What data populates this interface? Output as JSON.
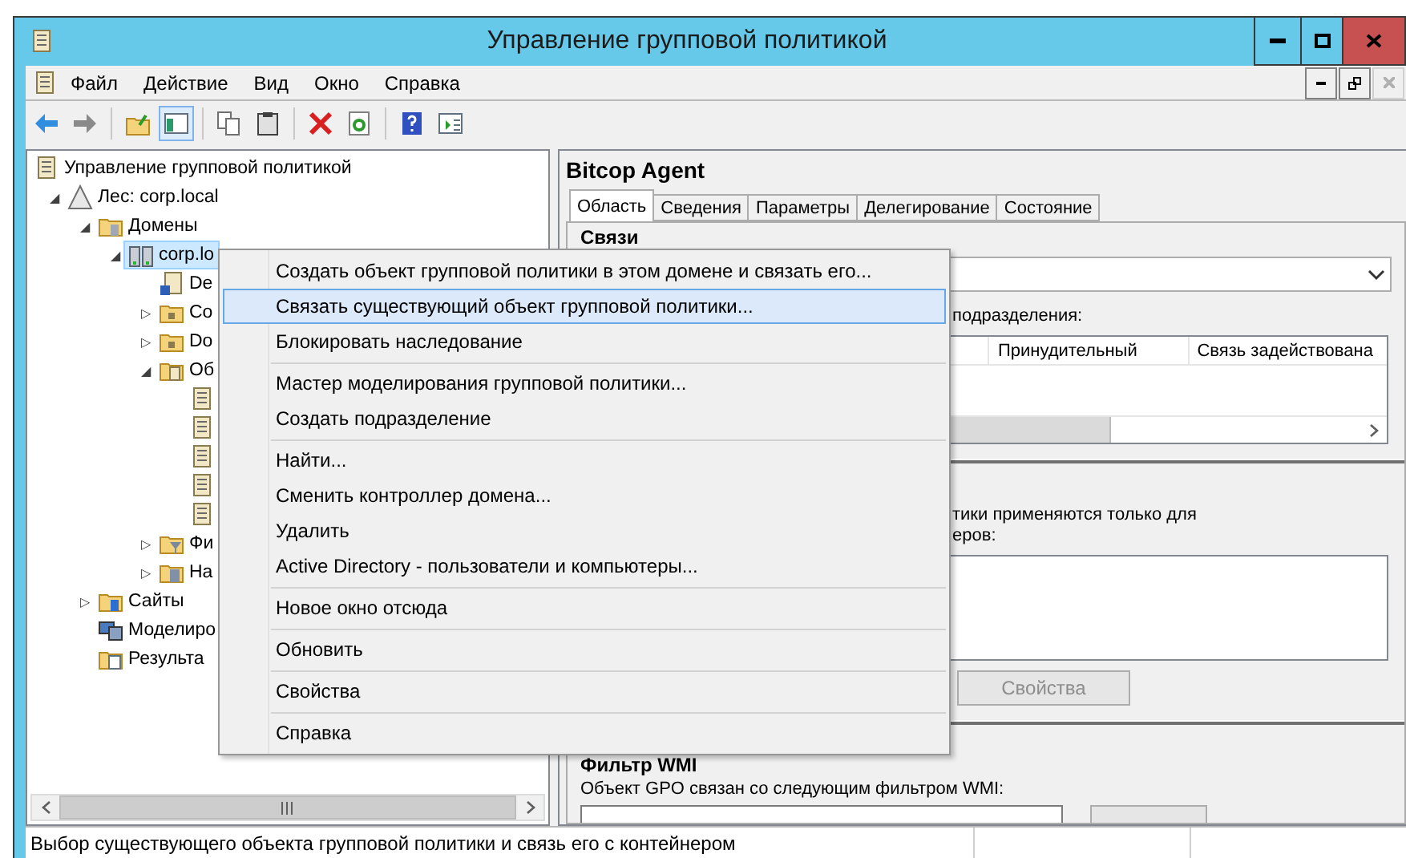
{
  "window": {
    "title": "Управление групповой политикой"
  },
  "menu_bar": [
    "Файл",
    "Действие",
    "Вид",
    "Окно",
    "Справка"
  ],
  "toolbar": [
    {
      "kind": "back",
      "pressed": false
    },
    {
      "kind": "forward",
      "pressed": false
    },
    {
      "kind": "sep"
    },
    {
      "kind": "up",
      "pressed": false
    },
    {
      "kind": "tree",
      "pressed": true
    },
    {
      "kind": "sep"
    },
    {
      "kind": "copy",
      "pressed": false
    },
    {
      "kind": "paste",
      "pressed": false
    },
    {
      "kind": "sep"
    },
    {
      "kind": "delete",
      "pressed": false
    },
    {
      "kind": "refresh",
      "pressed": false
    },
    {
      "kind": "sep"
    },
    {
      "kind": "help",
      "pressed": false
    },
    {
      "kind": "panel",
      "pressed": false
    }
  ],
  "tree": {
    "label": "Управление групповой политикой",
    "kind": "scroll",
    "selected": false,
    "children": [
      {
        "label": "Лес: corp.local",
        "kind": "forest",
        "toggle": "◢",
        "selected": false,
        "children": [
          {
            "label": "Домены",
            "kind": "domains",
            "toggle": "◢",
            "selected": false,
            "children": [
              {
                "label": "corp.lo",
                "kind": "domain",
                "toggle": "◢",
                "selected": true,
                "children": [
                  {
                    "label": "De",
                    "kind": "link",
                    "selected": false
                  },
                  {
                    "label": "Co",
                    "kind": "ou",
                    "toggle": "▷",
                    "selected": false
                  },
                  {
                    "label": "Do",
                    "kind": "ou",
                    "toggle": "▷",
                    "selected": false
                  },
                  {
                    "label": "Об",
                    "kind": "gpofolder",
                    "toggle": "◢",
                    "selected": false,
                    "children": [
                      {
                        "kind": "gpo",
                        "selected": false
                      },
                      {
                        "kind": "gpo",
                        "selected": false
                      },
                      {
                        "kind": "gpo",
                        "selected": false
                      },
                      {
                        "kind": "gpo",
                        "selected": false
                      },
                      {
                        "kind": "gpo",
                        "selected": false
                      }
                    ]
                  },
                  {
                    "label": "Фи",
                    "kind": "wmi",
                    "toggle": "▷",
                    "selected": false
                  },
                  {
                    "label": "На",
                    "kind": "starter",
                    "toggle": "▷",
                    "selected": false
                  }
                ]
              }
            ]
          },
          {
            "label": "Сайты",
            "kind": "sites",
            "toggle": "▷",
            "selected": false
          },
          {
            "label": "Моделиро",
            "kind": "modeling",
            "selected": false
          },
          {
            "label": "Результа",
            "kind": "results",
            "selected": false
          }
        ]
      }
    ]
  },
  "details": {
    "title": "Bitcop Agent",
    "tabs": [
      {
        "label": "Область",
        "selected": true
      },
      {
        "label": "Сведения",
        "selected": false
      },
      {
        "label": "Параметры",
        "selected": false
      },
      {
        "label": "Делегирование",
        "selected": false
      },
      {
        "label": "Состояние",
        "selected": false
      }
    ],
    "links_heading": "Связи",
    "links_caption": "подразделения:",
    "links_columns": [
      "Принудительный",
      "Связь задействована"
    ],
    "filter_caption_lines": [
      "тики применяются только для",
      "еров:"
    ],
    "properties_button": {
      "label": "Свойства",
      "disabled": true
    },
    "wmi_heading": "Фильтр WMI",
    "wmi_caption": "Объект GPO связан со следующим фильтром WMI:"
  },
  "context_menu": {
    "groups": [
      {
        "items": [
          {
            "label": "Создать объект групповой политики в этом домене и связать его...",
            "selected": false
          },
          {
            "label": "Связать существующий объект групповой политики...",
            "selected": true
          },
          {
            "label": "Блокировать наследование",
            "selected": false
          }
        ]
      },
      {
        "items": [
          {
            "label": "Мастер моделирования групповой политики...",
            "selected": false
          },
          {
            "label": "Создать подразделение",
            "selected": false
          }
        ]
      },
      {
        "items": [
          {
            "label": "Найти...",
            "selected": false
          },
          {
            "label": "Сменить контроллер домена...",
            "selected": false
          },
          {
            "label": "Удалить",
            "selected": false
          },
          {
            "label": "Active Directory - пользователи и компьютеры...",
            "selected": false
          }
        ]
      },
      {
        "items": [
          {
            "label": "Новое окно отсюда",
            "selected": false
          }
        ]
      },
      {
        "items": [
          {
            "label": "Обновить",
            "selected": false
          }
        ]
      },
      {
        "items": [
          {
            "label": "Свойства",
            "selected": false
          }
        ]
      },
      {
        "items": [
          {
            "label": "Справка",
            "selected": false
          }
        ]
      }
    ]
  },
  "status_bar": "Выбор существующего объекта групповой политики и связь его с контейнером"
}
